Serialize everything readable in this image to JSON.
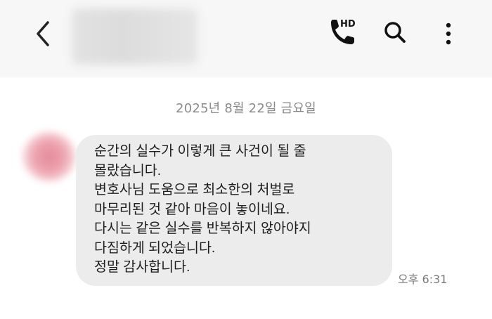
{
  "header": {
    "back_icon": "chevron-left-icon",
    "call_icon": "phone-hd-icon",
    "call_badge": "HD",
    "search_icon": "search-icon",
    "more_icon": "vertical-dots-icon"
  },
  "chat": {
    "date_separator": "2025년 8월 22일 금요일",
    "messages": [
      {
        "text": "순간의 실수가 이렇게 큰 사건이 될 줄\n몰랐습니다.\n변호사님 도움으로 최소한의 처벌로\n마무리된 것 같아 마음이 놓이네요.\n다시는 같은 실수를 반복하지 않아야지\n다짐하게 되었습니다.\n정말 감사합니다.",
        "time": "오후 6:31"
      }
    ]
  },
  "colors": {
    "header_bg": "#f7f7f7",
    "bubble_bg": "#ececec",
    "text": "#1e1e1e",
    "meta_text": "#8a8a8a"
  }
}
